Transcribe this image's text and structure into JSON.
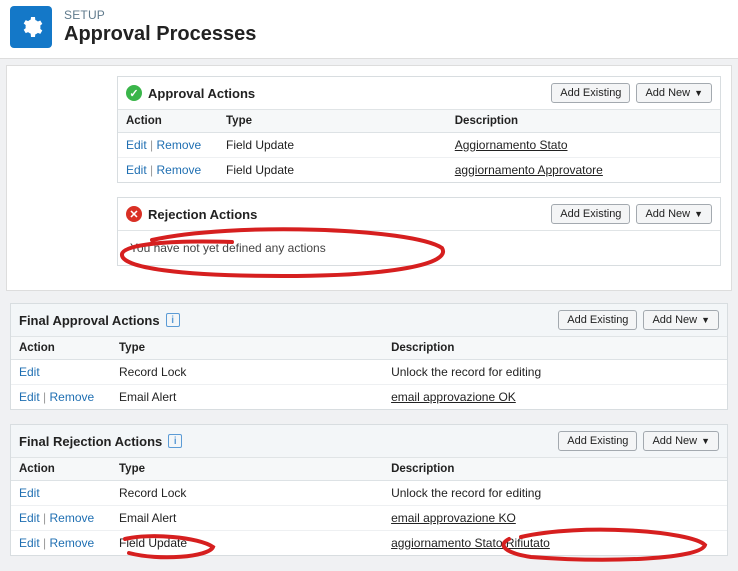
{
  "header": {
    "setup_label": "SETUP",
    "page_title": "Approval Processes"
  },
  "labels": {
    "add_existing": "Add Existing",
    "add_new": "Add New",
    "edit": "Edit",
    "remove": "Remove",
    "col_action": "Action",
    "col_type": "Type",
    "col_desc": "Description"
  },
  "sections": {
    "approval": {
      "title": "Approval Actions"
    },
    "rejection": {
      "title": "Rejection Actions",
      "empty": "You have not yet defined any actions"
    },
    "final_approval": {
      "title": "Final Approval Actions"
    },
    "final_rejection": {
      "title": "Final Rejection Actions"
    }
  },
  "approval_rows": [
    {
      "type": "Field Update",
      "desc": "Aggiornamento Stato",
      "desc_link": true,
      "removable": true
    },
    {
      "type": "Field Update",
      "desc": "aggiornamento Approvatore",
      "desc_link": true,
      "removable": true
    }
  ],
  "final_approval_rows": [
    {
      "type": "Record Lock",
      "desc": "Unlock the record for editing",
      "desc_link": false,
      "removable": false
    },
    {
      "type": "Email Alert",
      "desc": "email approvazione OK",
      "desc_link": true,
      "removable": true
    }
  ],
  "final_rejection_rows": [
    {
      "type": "Record Lock",
      "desc": "Unlock the record for editing",
      "desc_link": false,
      "removable": false
    },
    {
      "type": "Email Alert",
      "desc": "email approvazione KO",
      "desc_link": true,
      "removable": true
    },
    {
      "type": "Field Update",
      "desc": "aggiornamento Stato Rifiutato",
      "desc_link": true,
      "removable": true
    }
  ]
}
